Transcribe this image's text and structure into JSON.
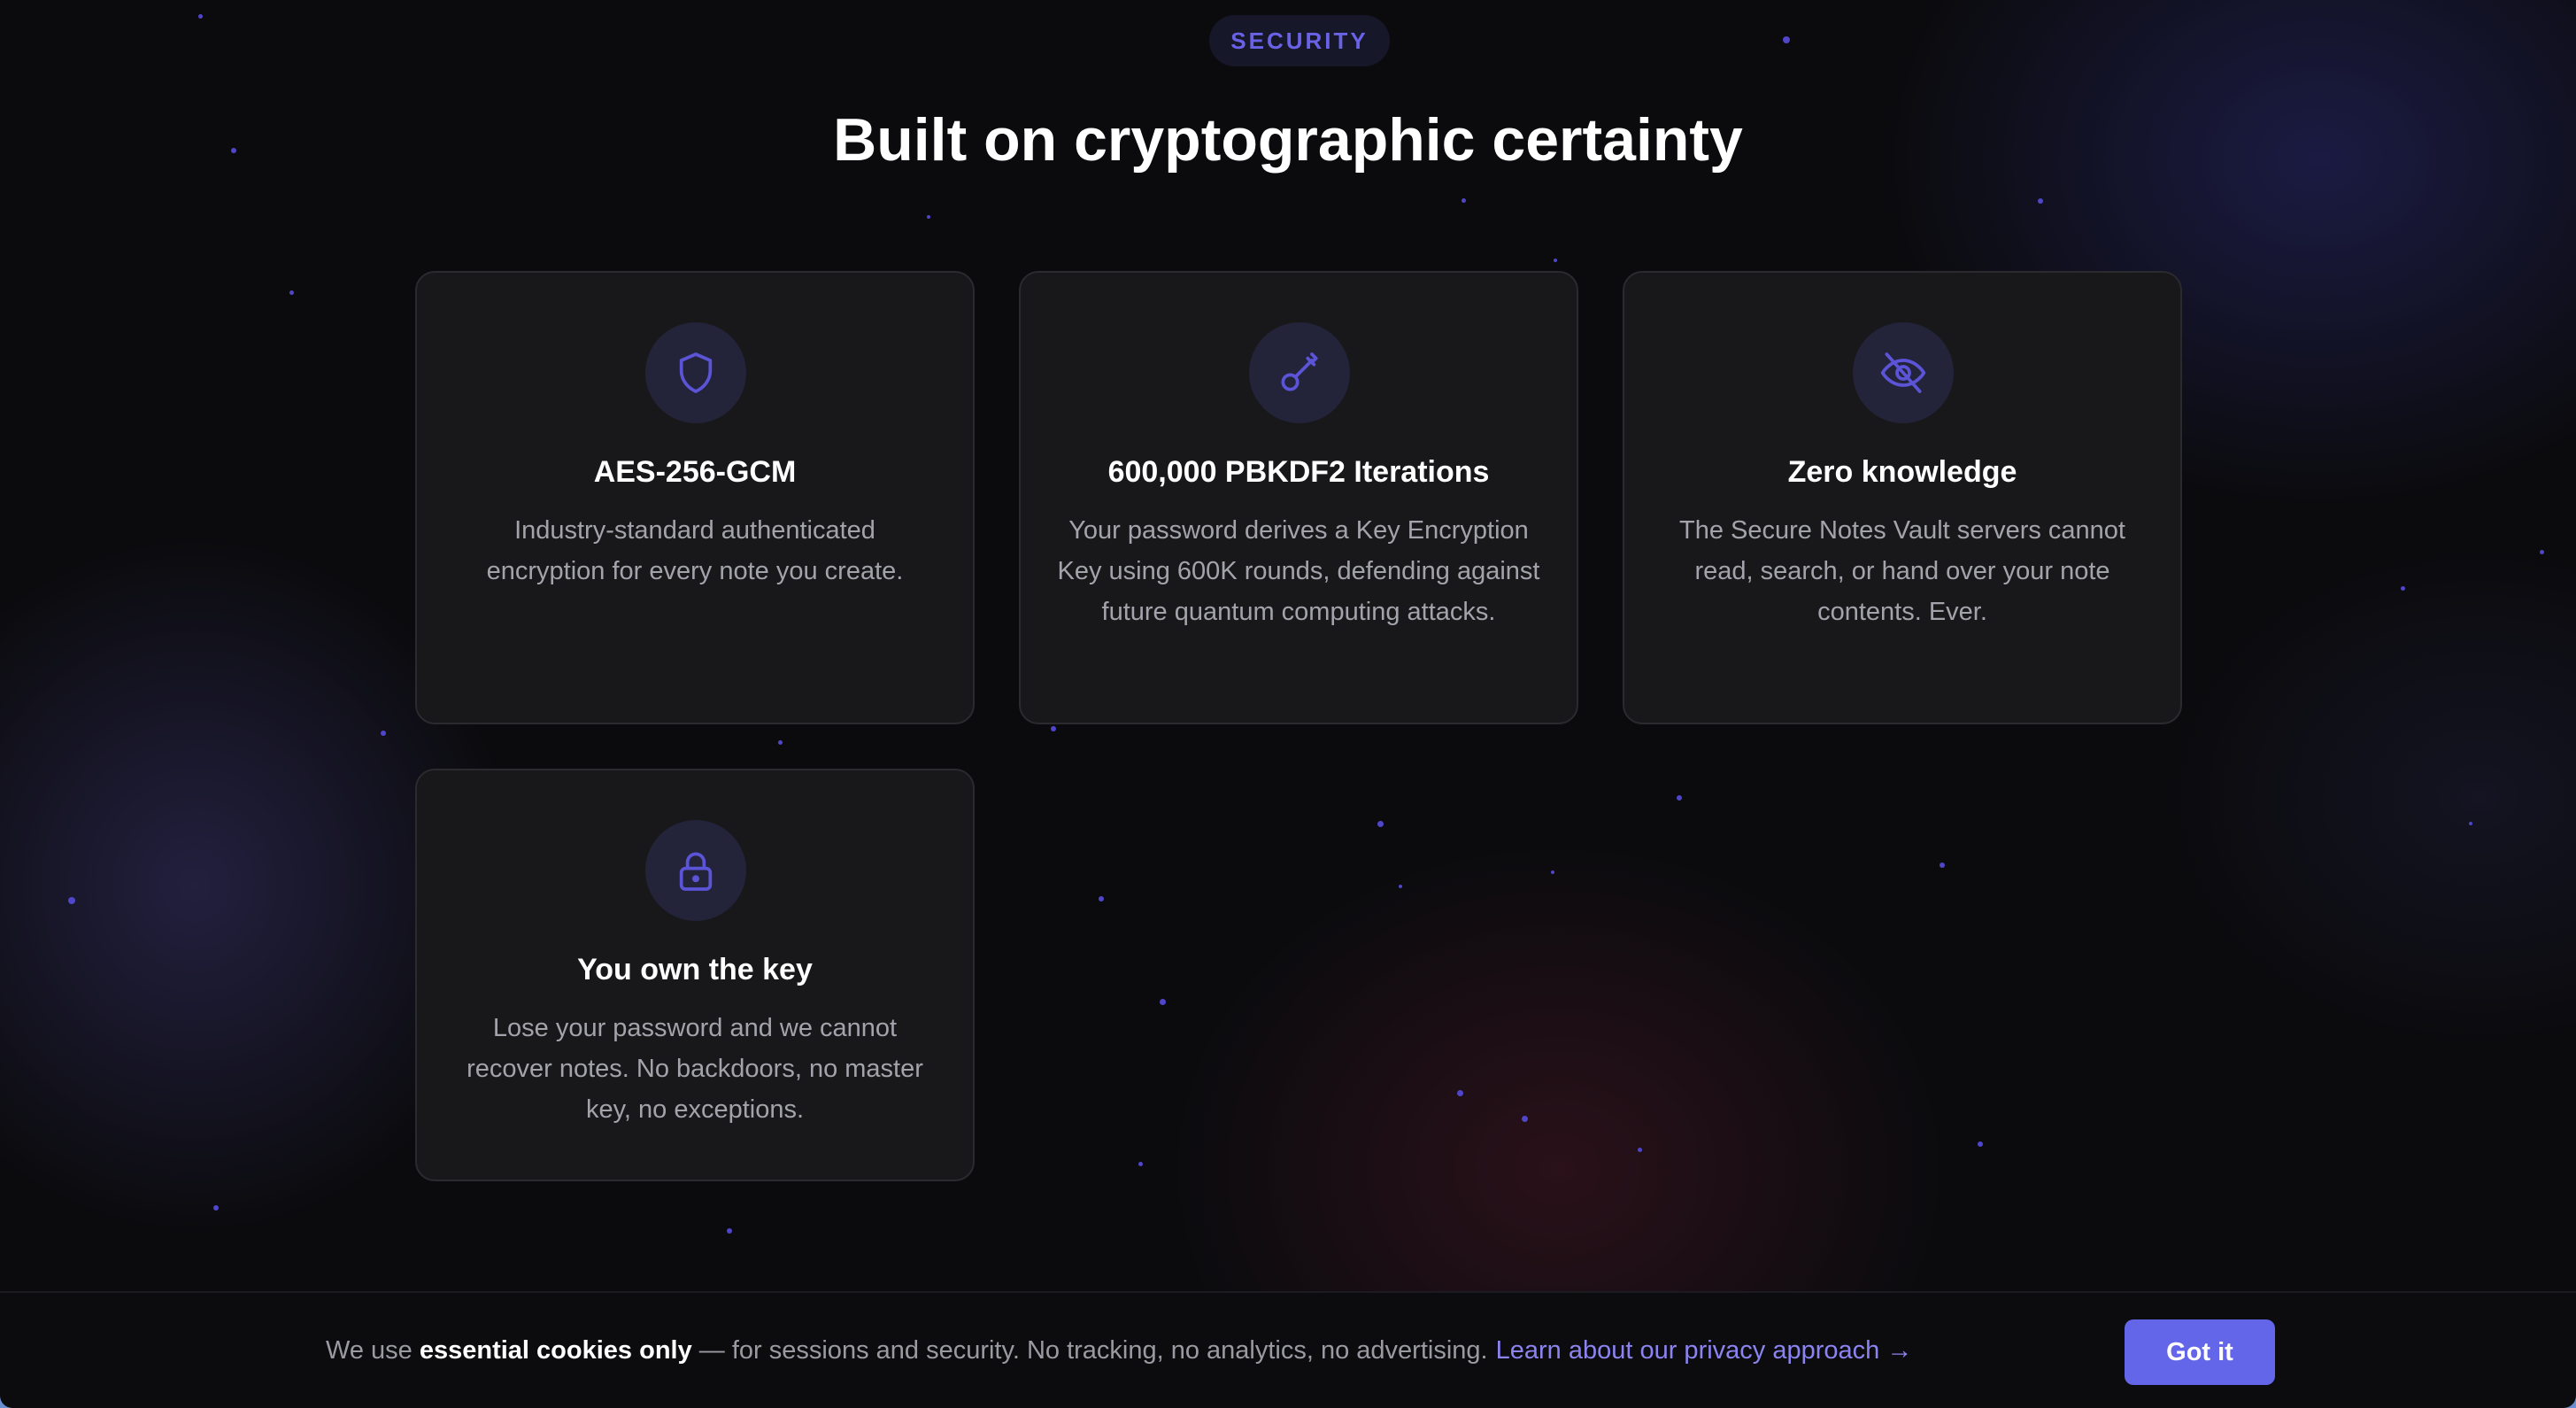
{
  "section": {
    "badge": "SECURITY",
    "heading": "Built on cryptographic certainty"
  },
  "cards": [
    {
      "icon": "shield-icon",
      "title": "AES-256-GCM",
      "description": "Industry-standard authenticated encryption for every note you create."
    },
    {
      "icon": "key-icon",
      "title": "600,000 PBKDF2 Iterations",
      "description": "Your password derives a Key Encryption Key using 600K rounds, defending against future quantum computing attacks."
    },
    {
      "icon": "eye-off-icon",
      "title": "Zero knowledge",
      "description": "The Secure Notes Vault servers cannot read, search, or hand over your note contents. Ever."
    },
    {
      "icon": "lock-icon",
      "title": "You own the key",
      "description": "Lose your password and we cannot recover notes. No backdoors, no master key, no exceptions."
    }
  ],
  "cookie_banner": {
    "prefix": "We use",
    "emphasis": "essential cookies only",
    "body": "— for sessions and security. No tracking, no analytics, no advertising.",
    "link": "Learn about our privacy approach →",
    "button": "Got it"
  },
  "colors": {
    "accent": "#6366e8",
    "icon_stroke": "#5b54d6",
    "link": "#8b84f0"
  }
}
